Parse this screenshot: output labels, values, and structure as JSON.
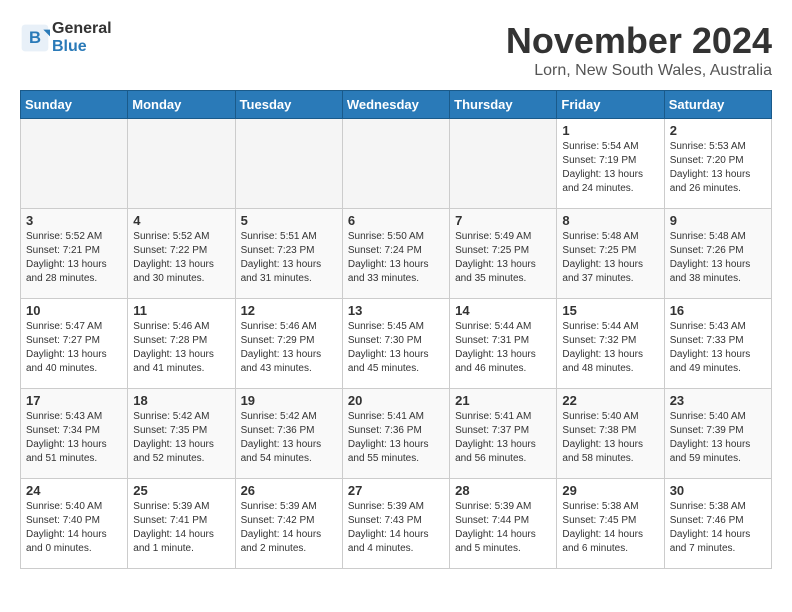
{
  "header": {
    "logo_general": "General",
    "logo_blue": "Blue",
    "month_year": "November 2024",
    "location": "Lorn, New South Wales, Australia"
  },
  "days_of_week": [
    "Sunday",
    "Monday",
    "Tuesday",
    "Wednesday",
    "Thursday",
    "Friday",
    "Saturday"
  ],
  "weeks": [
    [
      {
        "day": "",
        "info": ""
      },
      {
        "day": "",
        "info": ""
      },
      {
        "day": "",
        "info": ""
      },
      {
        "day": "",
        "info": ""
      },
      {
        "day": "",
        "info": ""
      },
      {
        "day": "1",
        "info": "Sunrise: 5:54 AM\nSunset: 7:19 PM\nDaylight: 13 hours\nand 24 minutes."
      },
      {
        "day": "2",
        "info": "Sunrise: 5:53 AM\nSunset: 7:20 PM\nDaylight: 13 hours\nand 26 minutes."
      }
    ],
    [
      {
        "day": "3",
        "info": "Sunrise: 5:52 AM\nSunset: 7:21 PM\nDaylight: 13 hours\nand 28 minutes."
      },
      {
        "day": "4",
        "info": "Sunrise: 5:52 AM\nSunset: 7:22 PM\nDaylight: 13 hours\nand 30 minutes."
      },
      {
        "day": "5",
        "info": "Sunrise: 5:51 AM\nSunset: 7:23 PM\nDaylight: 13 hours\nand 31 minutes."
      },
      {
        "day": "6",
        "info": "Sunrise: 5:50 AM\nSunset: 7:24 PM\nDaylight: 13 hours\nand 33 minutes."
      },
      {
        "day": "7",
        "info": "Sunrise: 5:49 AM\nSunset: 7:25 PM\nDaylight: 13 hours\nand 35 minutes."
      },
      {
        "day": "8",
        "info": "Sunrise: 5:48 AM\nSunset: 7:25 PM\nDaylight: 13 hours\nand 37 minutes."
      },
      {
        "day": "9",
        "info": "Sunrise: 5:48 AM\nSunset: 7:26 PM\nDaylight: 13 hours\nand 38 minutes."
      }
    ],
    [
      {
        "day": "10",
        "info": "Sunrise: 5:47 AM\nSunset: 7:27 PM\nDaylight: 13 hours\nand 40 minutes."
      },
      {
        "day": "11",
        "info": "Sunrise: 5:46 AM\nSunset: 7:28 PM\nDaylight: 13 hours\nand 41 minutes."
      },
      {
        "day": "12",
        "info": "Sunrise: 5:46 AM\nSunset: 7:29 PM\nDaylight: 13 hours\nand 43 minutes."
      },
      {
        "day": "13",
        "info": "Sunrise: 5:45 AM\nSunset: 7:30 PM\nDaylight: 13 hours\nand 45 minutes."
      },
      {
        "day": "14",
        "info": "Sunrise: 5:44 AM\nSunset: 7:31 PM\nDaylight: 13 hours\nand 46 minutes."
      },
      {
        "day": "15",
        "info": "Sunrise: 5:44 AM\nSunset: 7:32 PM\nDaylight: 13 hours\nand 48 minutes."
      },
      {
        "day": "16",
        "info": "Sunrise: 5:43 AM\nSunset: 7:33 PM\nDaylight: 13 hours\nand 49 minutes."
      }
    ],
    [
      {
        "day": "17",
        "info": "Sunrise: 5:43 AM\nSunset: 7:34 PM\nDaylight: 13 hours\nand 51 minutes."
      },
      {
        "day": "18",
        "info": "Sunrise: 5:42 AM\nSunset: 7:35 PM\nDaylight: 13 hours\nand 52 minutes."
      },
      {
        "day": "19",
        "info": "Sunrise: 5:42 AM\nSunset: 7:36 PM\nDaylight: 13 hours\nand 54 minutes."
      },
      {
        "day": "20",
        "info": "Sunrise: 5:41 AM\nSunset: 7:36 PM\nDaylight: 13 hours\nand 55 minutes."
      },
      {
        "day": "21",
        "info": "Sunrise: 5:41 AM\nSunset: 7:37 PM\nDaylight: 13 hours\nand 56 minutes."
      },
      {
        "day": "22",
        "info": "Sunrise: 5:40 AM\nSunset: 7:38 PM\nDaylight: 13 hours\nand 58 minutes."
      },
      {
        "day": "23",
        "info": "Sunrise: 5:40 AM\nSunset: 7:39 PM\nDaylight: 13 hours\nand 59 minutes."
      }
    ],
    [
      {
        "day": "24",
        "info": "Sunrise: 5:40 AM\nSunset: 7:40 PM\nDaylight: 14 hours\nand 0 minutes."
      },
      {
        "day": "25",
        "info": "Sunrise: 5:39 AM\nSunset: 7:41 PM\nDaylight: 14 hours\nand 1 minute."
      },
      {
        "day": "26",
        "info": "Sunrise: 5:39 AM\nSunset: 7:42 PM\nDaylight: 14 hours\nand 2 minutes."
      },
      {
        "day": "27",
        "info": "Sunrise: 5:39 AM\nSunset: 7:43 PM\nDaylight: 14 hours\nand 4 minutes."
      },
      {
        "day": "28",
        "info": "Sunrise: 5:39 AM\nSunset: 7:44 PM\nDaylight: 14 hours\nand 5 minutes."
      },
      {
        "day": "29",
        "info": "Sunrise: 5:38 AM\nSunset: 7:45 PM\nDaylight: 14 hours\nand 6 minutes."
      },
      {
        "day": "30",
        "info": "Sunrise: 5:38 AM\nSunset: 7:46 PM\nDaylight: 14 hours\nand 7 minutes."
      }
    ]
  ]
}
